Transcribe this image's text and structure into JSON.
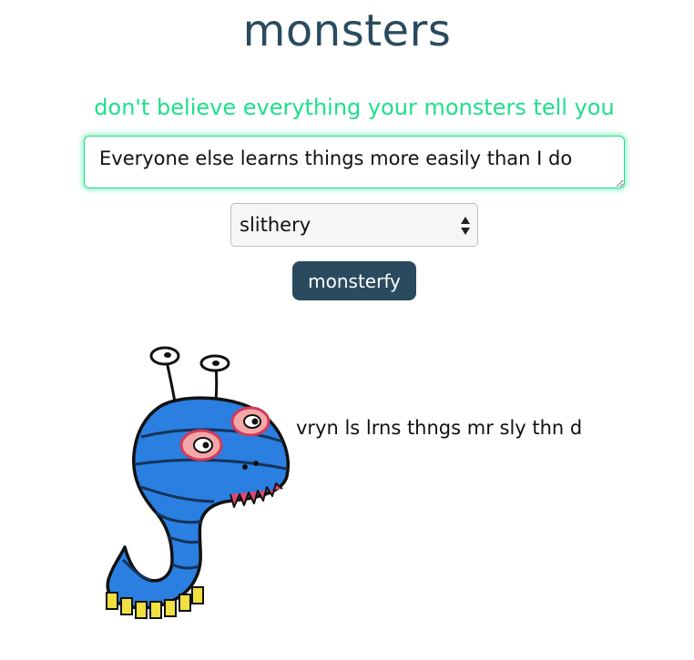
{
  "header": {
    "title": "monsters",
    "subtitle": "don't believe everything your monsters tell you"
  },
  "form": {
    "thought_value": "Everyone else learns things more easily than I do",
    "monster_type_selected": "slithery",
    "submit_label": "monsterfy"
  },
  "result": {
    "monster_name": "slithery-monster-icon",
    "monster_text": "vryn ls lrns thngs mr sly thn d"
  },
  "colors": {
    "title": "#2a4b5f",
    "accent": "#1ee08a",
    "button": "#2a4b5f",
    "monster_body": "#2a7fe0",
    "monster_teeth": "#f0e040"
  }
}
